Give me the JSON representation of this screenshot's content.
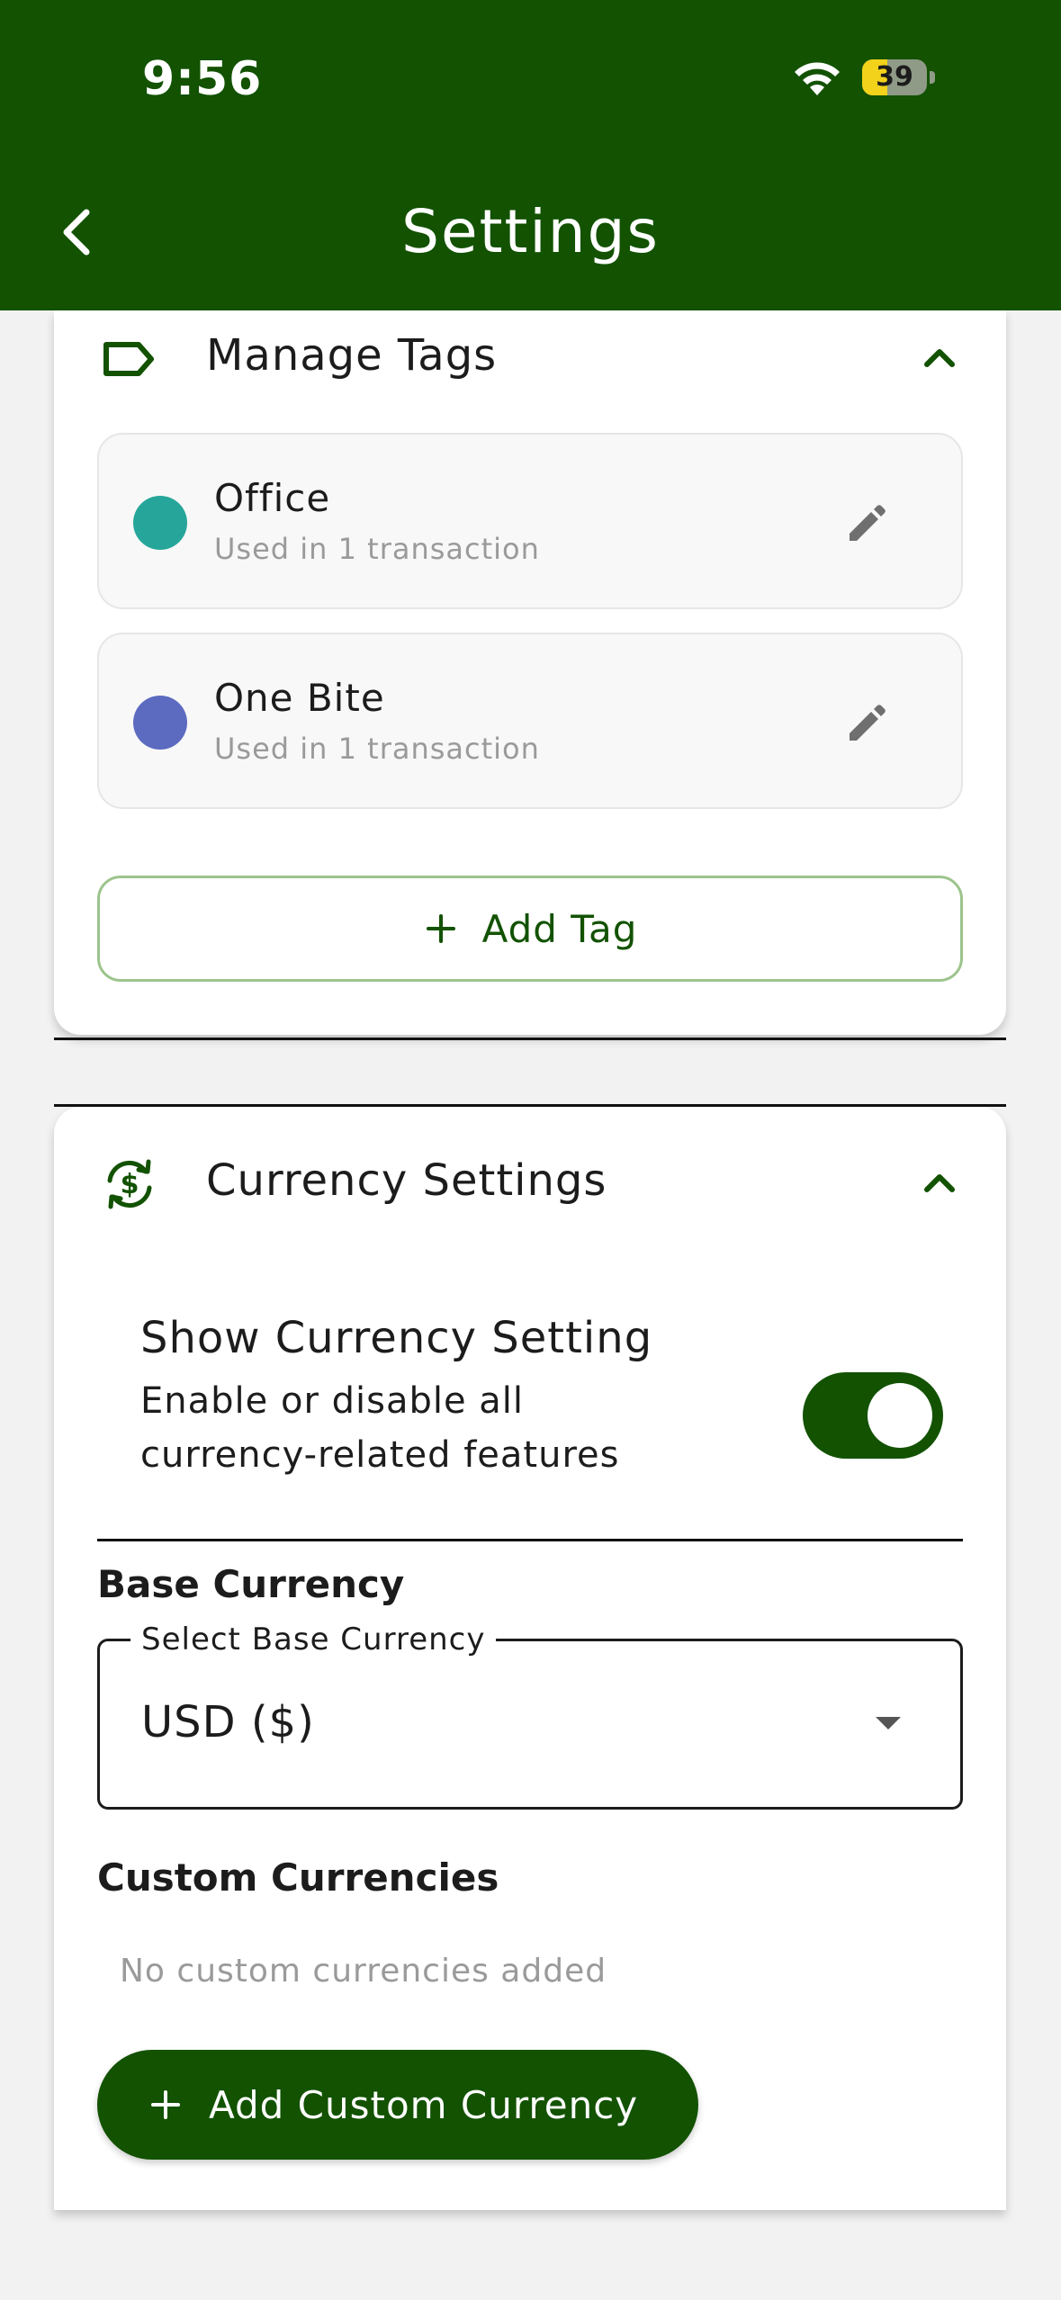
{
  "status_bar": {
    "time": "9:56",
    "battery_level": "39",
    "battery_fraction": 0.39
  },
  "header": {
    "title": "Settings",
    "back_icon": "chevron-left-icon",
    "background": "#125200"
  },
  "tags_section": {
    "title": "Manage Tags",
    "icon": "tag-outline-icon",
    "tags": [
      {
        "name": "Office",
        "usage": "Used in 1 transaction",
        "color": "#26A69A"
      },
      {
        "name": "One Bite",
        "usage": "Used in 1 transaction",
        "color": "#5C6BC0"
      }
    ],
    "add_button_label": "Add Tag"
  },
  "currency_section": {
    "title": "Currency Settings",
    "icon": "currency-exchange-icon",
    "show_setting": {
      "title": "Show Currency Setting",
      "description": "Enable or disable all currency-related features",
      "enabled": true
    },
    "base_currency": {
      "label": "Base Currency",
      "field_label": "Select Base Currency",
      "value": "USD ($)"
    },
    "custom_currencies": {
      "label": "Custom Currencies",
      "empty_text": "No custom currencies added"
    },
    "add_button_label": "Add Custom Currency"
  },
  "colors": {
    "primary": "#125200",
    "outline": "#9CC48C",
    "muted_text": "#9A9A9A"
  }
}
